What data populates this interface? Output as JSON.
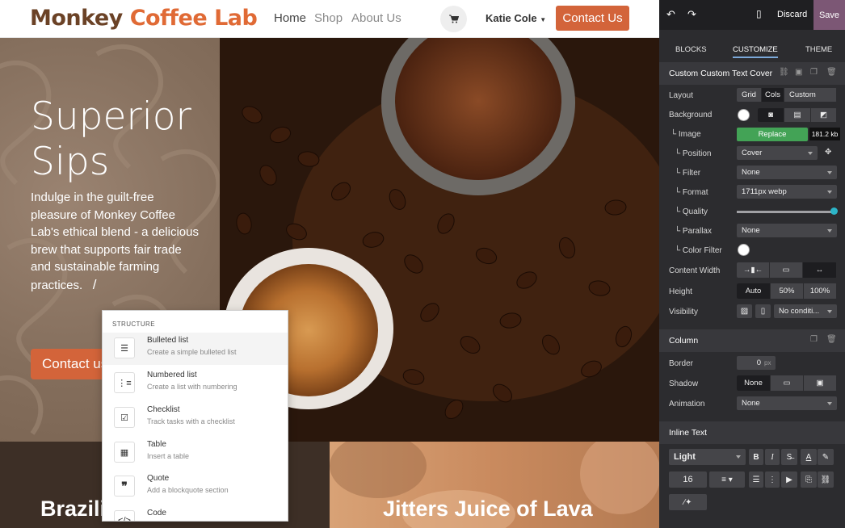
{
  "site": {
    "logo_part1": "Monkey ",
    "logo_part2": "Coffee",
    "logo_part3": " Lab",
    "nav": [
      "Home",
      "Shop",
      "About Us"
    ],
    "user_name": "Katie Cole",
    "cta": "Contact Us",
    "hero": {
      "title_line1": "Superior",
      "title_line2": "Sips",
      "text": "Indulge in the guilt-free pleasure of Monkey Coffee Lab's ethical blend - a delicious brew that supports fair trade and sustainable farming practices.",
      "cursor": "/",
      "button": "Contact us"
    },
    "cards": [
      {
        "title": "Brazilian Buzz"
      },
      {
        "title": "Jitters Juice of Lava"
      }
    ]
  },
  "popup": {
    "header": "Structure",
    "items": [
      {
        "title": "Bulleted list",
        "sub": "Create a simple bulleted list",
        "icon": "bulleted-list-icon"
      },
      {
        "title": "Numbered list",
        "sub": "Create a list with numbering",
        "icon": "numbered-list-icon"
      },
      {
        "title": "Checklist",
        "sub": "Track tasks with a checklist",
        "icon": "checklist-icon"
      },
      {
        "title": "Table",
        "sub": "Insert a table",
        "icon": "table-icon"
      },
      {
        "title": "Quote",
        "sub": "Add a blockquote section",
        "icon": "quote-icon"
      },
      {
        "title": "Code",
        "sub": "",
        "icon": "code-icon"
      }
    ]
  },
  "editor": {
    "discard": "Discard",
    "save": "Save",
    "tabs": [
      "BLOCKS",
      "CUSTOMIZE",
      "THEME"
    ],
    "block_title": "Custom Custom Text Cover",
    "layout_label": "Layout",
    "layout_opts": [
      "Grid",
      "Cols",
      "Custom"
    ],
    "background_label": "Background",
    "image_label": "└ Image",
    "replace": "Replace",
    "image_size": "181.2 kb",
    "position_label": "└ Position",
    "position_value": "Cover",
    "filter_label": "└ Filter",
    "filter_value": "None",
    "format_label": "└ Format",
    "format_value": "1711px webp",
    "quality_label": "└ Quality",
    "parallax_label": "└ Parallax",
    "parallax_value": "None",
    "color_filter_label": "└ Color Filter",
    "content_width_label": "Content Width",
    "height_label": "Height",
    "height_opts": [
      "Auto",
      "50%",
      "100%"
    ],
    "visibility_label": "Visibility",
    "visibility_value": "No conditi...",
    "column_title": "Column",
    "border_label": "Border",
    "border_value": "0",
    "border_unit": "px",
    "shadow_label": "Shadow",
    "shadow_value": "None",
    "animation_label": "Animation",
    "animation_value": "None",
    "inline_title": "Inline Text",
    "font_style": "Light",
    "font_size": "16"
  }
}
